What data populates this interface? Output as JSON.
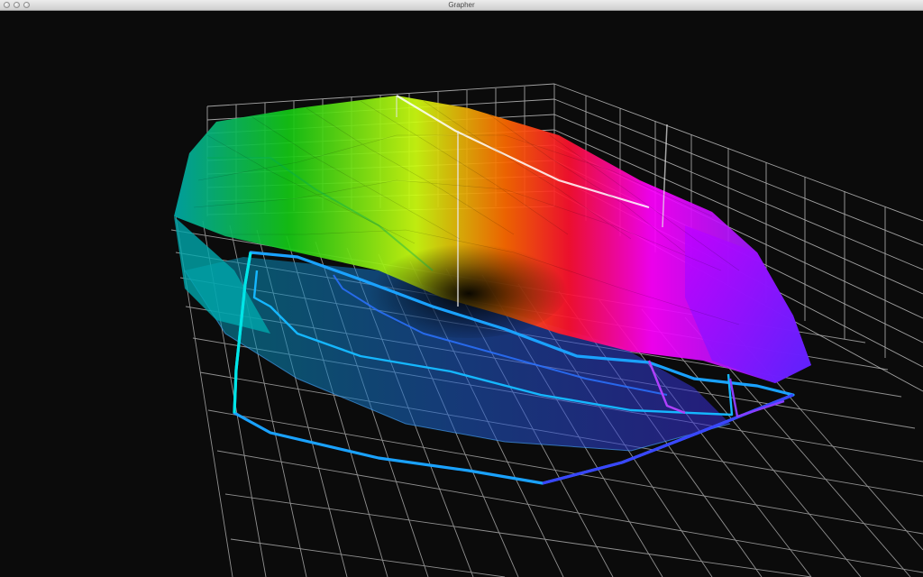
{
  "window": {
    "title": "Grapher"
  },
  "plot": {
    "kind": "3D gamut volume",
    "background": "#0b0b0b",
    "grid_color": "#c8c8c8",
    "outline_colors": [
      "#00e0e0",
      "#1a7dff",
      "#2a3cff",
      "#8a3cff",
      "#d040ff"
    ],
    "surface_colors": [
      "#00b2b2",
      "#1ed21e",
      "#e0ff10",
      "#ff4a00",
      "#ff00ff",
      "#4028ff"
    ]
  }
}
